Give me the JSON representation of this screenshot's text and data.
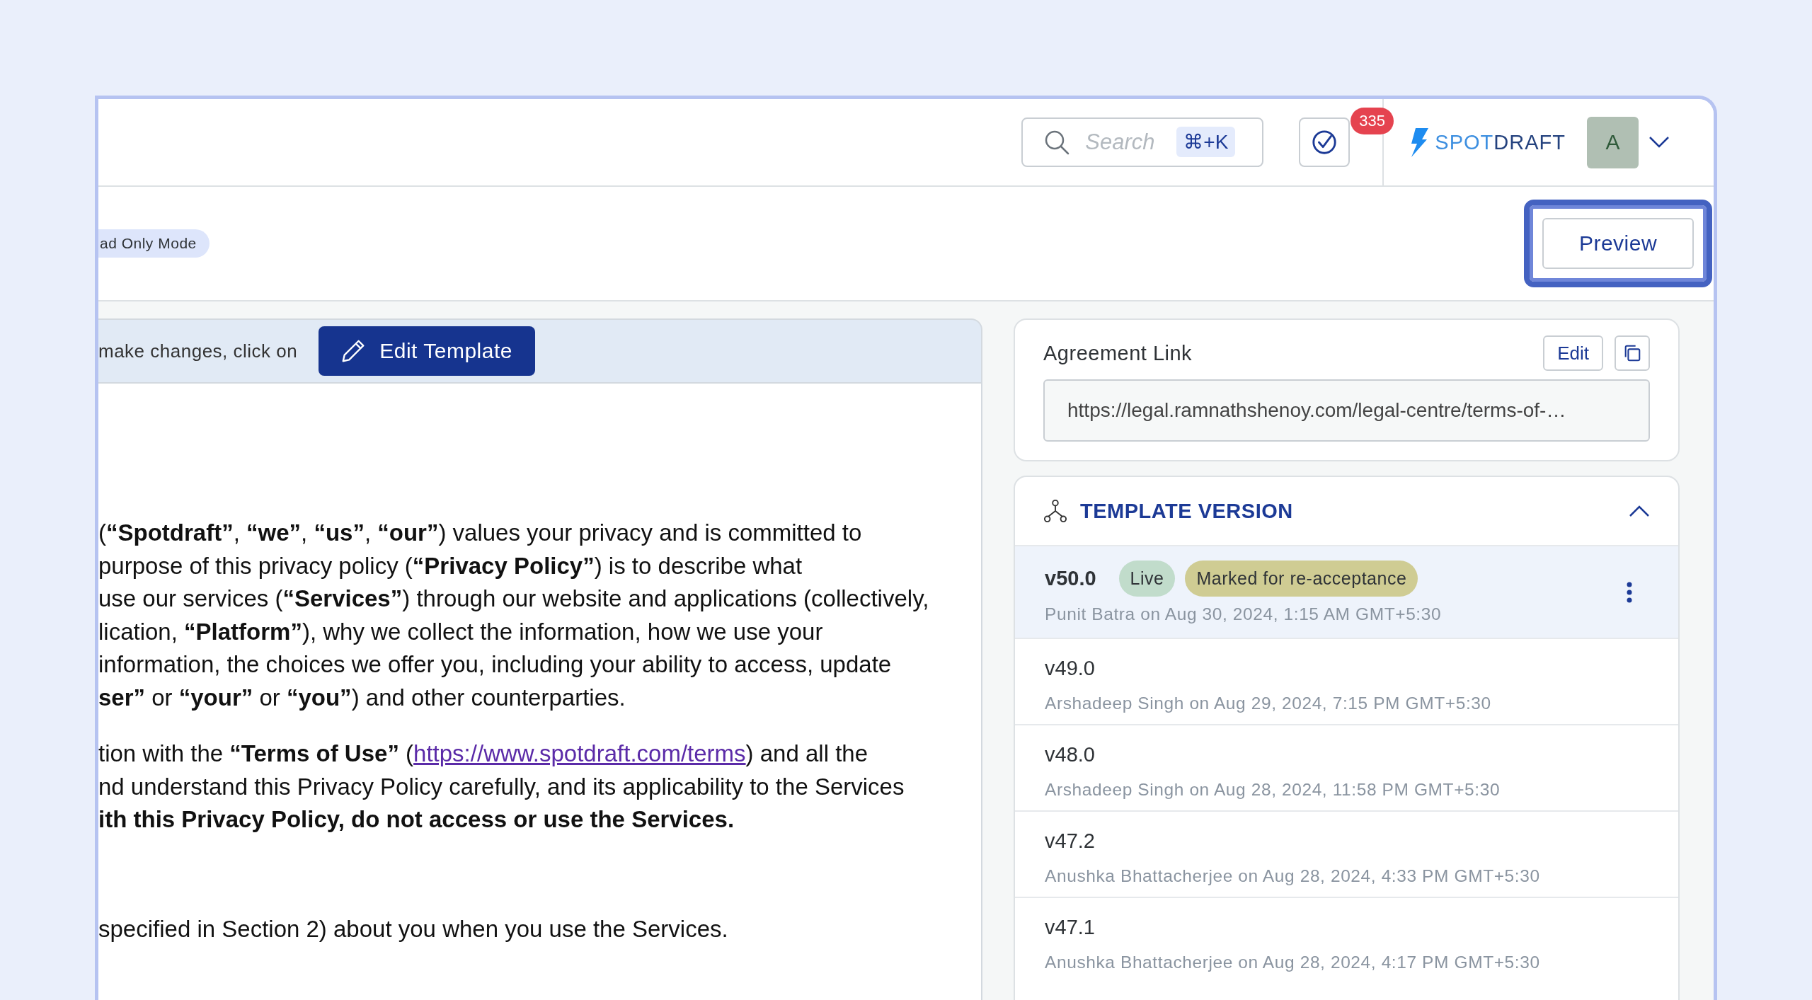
{
  "header": {
    "search": {
      "placeholder": "Search",
      "shortcut": "⌘+K"
    },
    "tasks_badge": "335",
    "logo": {
      "light": "SPOT",
      "bold": "DRAFT"
    },
    "avatar": "A"
  },
  "toolbar": {
    "mode_badge": "ad Only Mode",
    "preview_button": {
      "label": "Preview",
      "focused": true
    }
  },
  "editor": {
    "banner": {
      "text": "make changes, click on",
      "button": "Edit Template"
    },
    "paragraphs": [
      {
        "lines": [
          {
            "text": "(**“Spotdraft”**, **“we”**, **“us”**, **“our”**) values your privacy and is committed to"
          },
          {
            "text": "purpose of this privacy policy (**“Privacy Policy”**) is to describe what"
          },
          {
            "text": "use our services (**“Services”**) through our website and applications (collectively,"
          },
          {
            "text": "lication, **“Platform”**), why we collect the information, how we use your"
          },
          {
            "text": "information, the choices we offer you, including your ability to access, update"
          },
          {
            "text": "**ser”** or **“your”** or **“you”**) and other counterparties."
          }
        ]
      },
      {
        "lines": [
          {
            "text": "tion with the **“Terms of Use”** (",
            "link": "https://www.spotdraft.com/terms",
            "after": ") and all the"
          },
          {
            "text": "nd understand this Privacy Policy carefully, and its applicability to the Services"
          },
          {
            "text": "ith this Privacy Policy, do not access or use the Services.",
            "bold": true
          }
        ]
      },
      {
        "lines": [
          {
            "text": "specified in Section 2) about you when you use the Services."
          }
        ],
        "spaced": true
      }
    ]
  },
  "agreement_link": {
    "title": "Agreement Link",
    "edit_button": "Edit",
    "url": "https://legal.ramnathshenoy.com/legal-centre/terms-of-…"
  },
  "template_version": {
    "title": "TEMPLATE VERSION",
    "expanded": true,
    "versions": [
      {
        "version": "v50.0",
        "selected": true,
        "tags": [
          {
            "label": "Live",
            "color": "#c1dccb"
          },
          {
            "label": "Marked for re-acceptance",
            "color": "#cfcc93"
          }
        ],
        "meta": "Punit Batra on Aug 30, 2024, 1:15 AM GMT+5:30"
      },
      {
        "version": "v49.0",
        "selected": false,
        "meta": "Arshadeep Singh on Aug 29, 2024, 7:15 PM GMT+5:30"
      },
      {
        "version": "v48.0",
        "selected": false,
        "meta": "Arshadeep Singh on Aug 28, 2024, 11:58 PM GMT+5:30"
      },
      {
        "version": "v47.2",
        "selected": false,
        "meta": "Anushka Bhattacherjee on Aug 28, 2024, 4:33 PM GMT+5:30"
      },
      {
        "version": "v47.1",
        "selected": false,
        "meta": "Anushka Bhattacherjee on Aug 28, 2024, 4:17 PM GMT+5:30"
      }
    ]
  }
}
